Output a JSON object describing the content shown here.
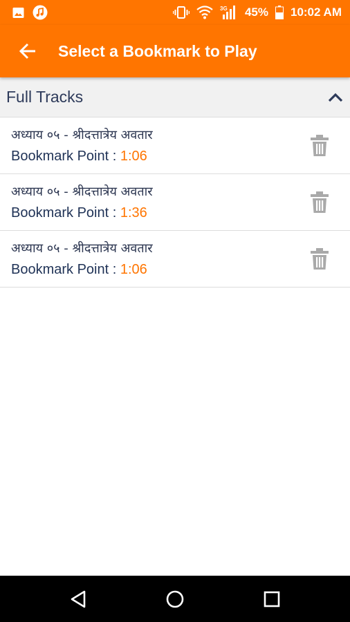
{
  "status_bar": {
    "battery_percent": "45%",
    "time": "10:02 AM",
    "network_type": "3G",
    "icons": [
      "image-icon",
      "music-icon",
      "vibrate-icon",
      "wifi-icon",
      "signal-icon",
      "battery-icon"
    ]
  },
  "app_bar": {
    "title": "Select a Bookmark to Play",
    "back_icon": "arrow-left-icon"
  },
  "section": {
    "title": "Full Tracks",
    "expanded_icon": "chevron-up-icon"
  },
  "bookmarks": [
    {
      "title": "अध्याय ०५ - श्रीदत्तात्रेय अवतार",
      "point_label": "Bookmark Point : ",
      "time": "1:06"
    },
    {
      "title": "अध्याय ०५ - श्रीदत्तात्रेय अवतार",
      "point_label": "Bookmark Point : ",
      "time": "1:36"
    },
    {
      "title": "अध्याय ०५ - श्रीदत्तात्रेय अवतार",
      "point_label": "Bookmark Point : ",
      "time": "1:06"
    }
  ],
  "nav_bar": {
    "icons": [
      "back-triangle-icon",
      "home-circle-icon",
      "recents-square-icon"
    ]
  },
  "colors": {
    "accent": "#ff7500",
    "header_bg": "#f1f1f1",
    "text_dark": "#1f3256"
  }
}
